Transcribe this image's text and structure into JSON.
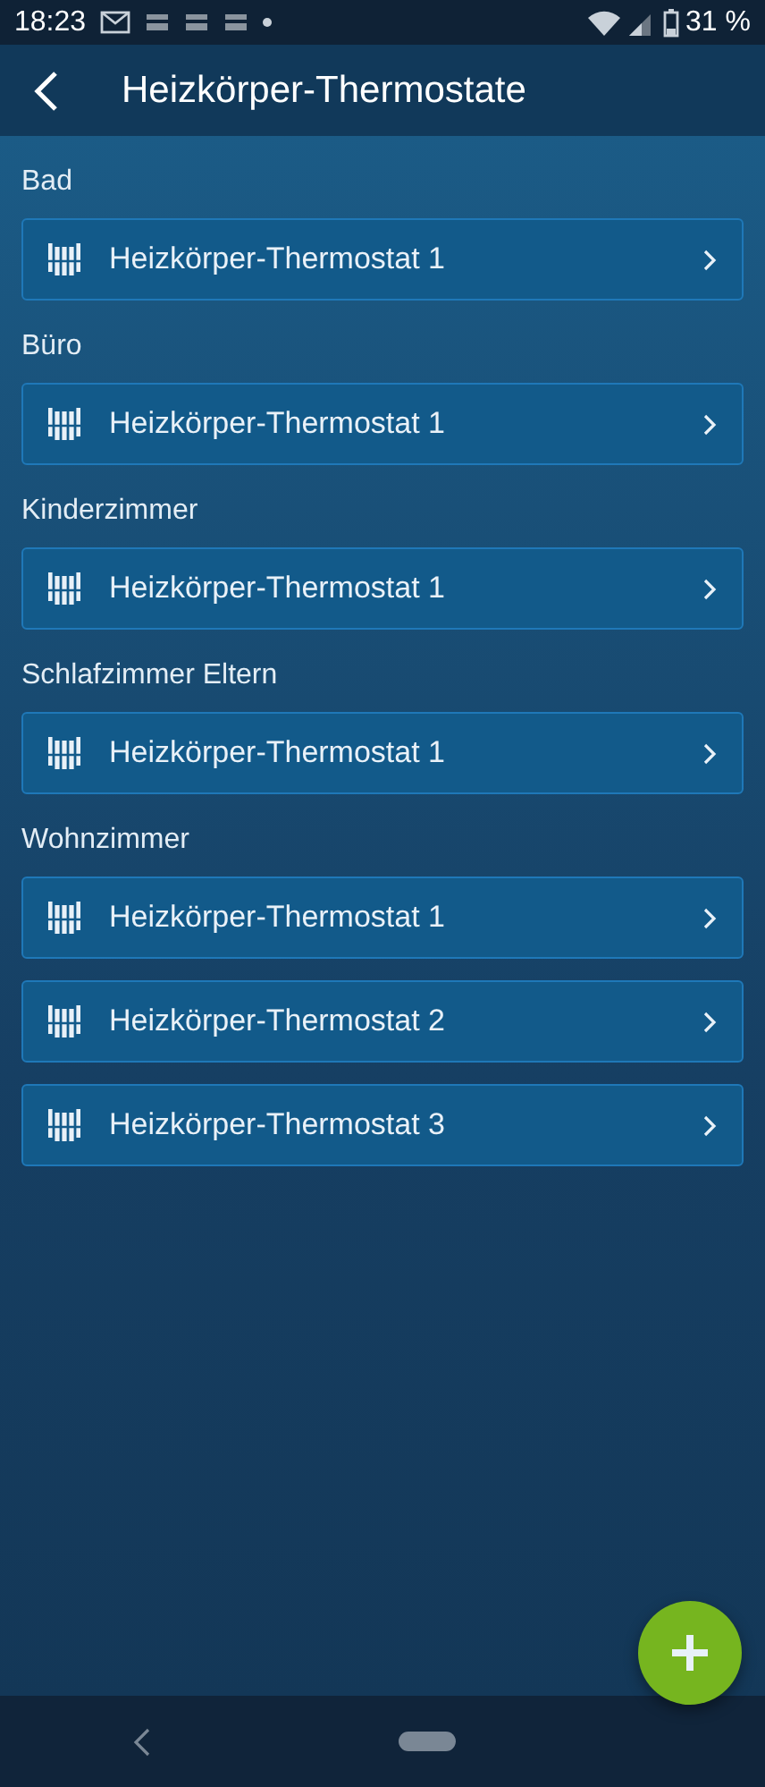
{
  "status_bar": {
    "time": "18:23",
    "battery": "31 %"
  },
  "header": {
    "title": "Heizkörper-Thermostate"
  },
  "rooms": [
    {
      "name": "Bad",
      "devices": [
        {
          "label": "Heizkörper-Thermostat 1"
        }
      ]
    },
    {
      "name": "Büro",
      "devices": [
        {
          "label": "Heizkörper-Thermostat 1"
        }
      ]
    },
    {
      "name": "Kinderzimmer",
      "devices": [
        {
          "label": "Heizkörper-Thermostat 1"
        }
      ]
    },
    {
      "name": "Schlafzimmer Eltern",
      "devices": [
        {
          "label": "Heizkörper-Thermostat 1"
        }
      ]
    },
    {
      "name": "Wohnzimmer",
      "devices": [
        {
          "label": "Heizkörper-Thermostat 1"
        },
        {
          "label": "Heizkörper-Thermostat 2"
        },
        {
          "label": "Heizkörper-Thermostat 3"
        }
      ]
    }
  ]
}
